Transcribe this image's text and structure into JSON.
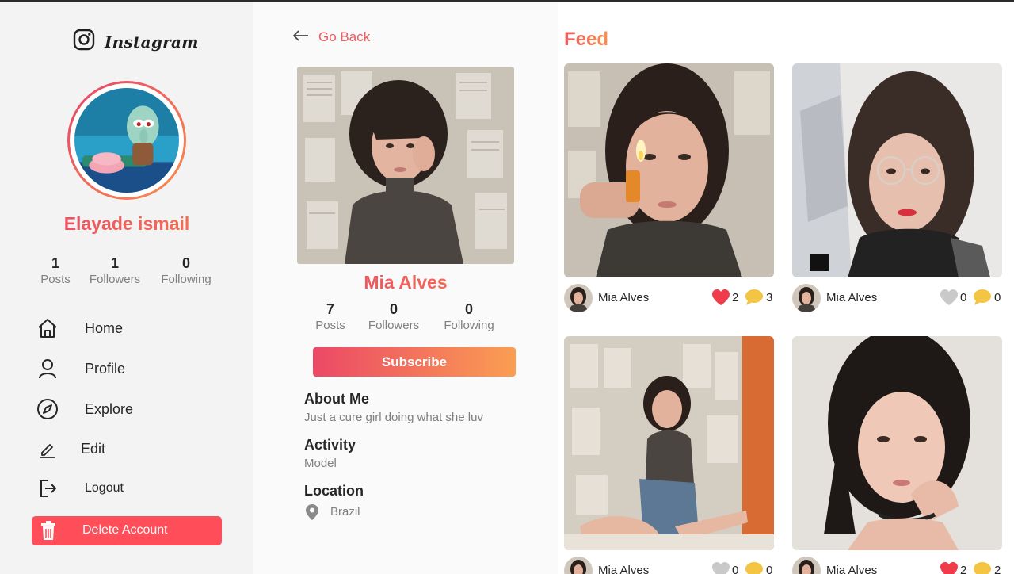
{
  "sidebar": {
    "logo_text": "Instagram",
    "user_name": "Elayade ismail",
    "stats": [
      {
        "value": "1",
        "label": "Posts"
      },
      {
        "value": "1",
        "label": "Followers"
      },
      {
        "value": "0",
        "label": "Following"
      }
    ],
    "nav": [
      {
        "label": "Home",
        "icon": "home-icon"
      },
      {
        "label": "Profile",
        "icon": "user-icon"
      },
      {
        "label": "Explore",
        "icon": "compass-icon"
      },
      {
        "label": "Edit",
        "icon": "pencil-icon"
      },
      {
        "label": "Logout",
        "icon": "logout-icon"
      }
    ],
    "delete_label": "Delete Account",
    "delete_color": "#ff4d5a"
  },
  "profile": {
    "back_label": "Go Back",
    "name": "Mia Alves",
    "stats": [
      {
        "value": "7",
        "label": "Posts"
      },
      {
        "value": "0",
        "label": "Followers"
      },
      {
        "value": "0",
        "label": "Following"
      }
    ],
    "subscribe_label": "Subscribe",
    "about_title": "About Me",
    "about_text": "Just a cure girl doing what she luv",
    "activity_title": "Activity",
    "activity_text": "Model",
    "location_title": "Location",
    "location_text": "Brazil"
  },
  "feed": {
    "title": "Feed",
    "posts": [
      {
        "author": "Mia Alves",
        "likes": "2",
        "comments": "3",
        "liked": true
      },
      {
        "author": "Mia Alves",
        "likes": "0",
        "comments": "0",
        "liked": false
      },
      {
        "author": "Mia Alves",
        "likes": "0",
        "comments": "0",
        "liked": false
      },
      {
        "author": "Mia Alves",
        "likes": "2",
        "comments": "2",
        "liked": true
      }
    ]
  },
  "colors": {
    "accent_gradient_start": "#e8436b",
    "accent_gradient_end": "#fa8f4d",
    "like_active": "#ef3b4a",
    "like_inactive": "#c9c9c9",
    "comment": "#f4c542"
  }
}
